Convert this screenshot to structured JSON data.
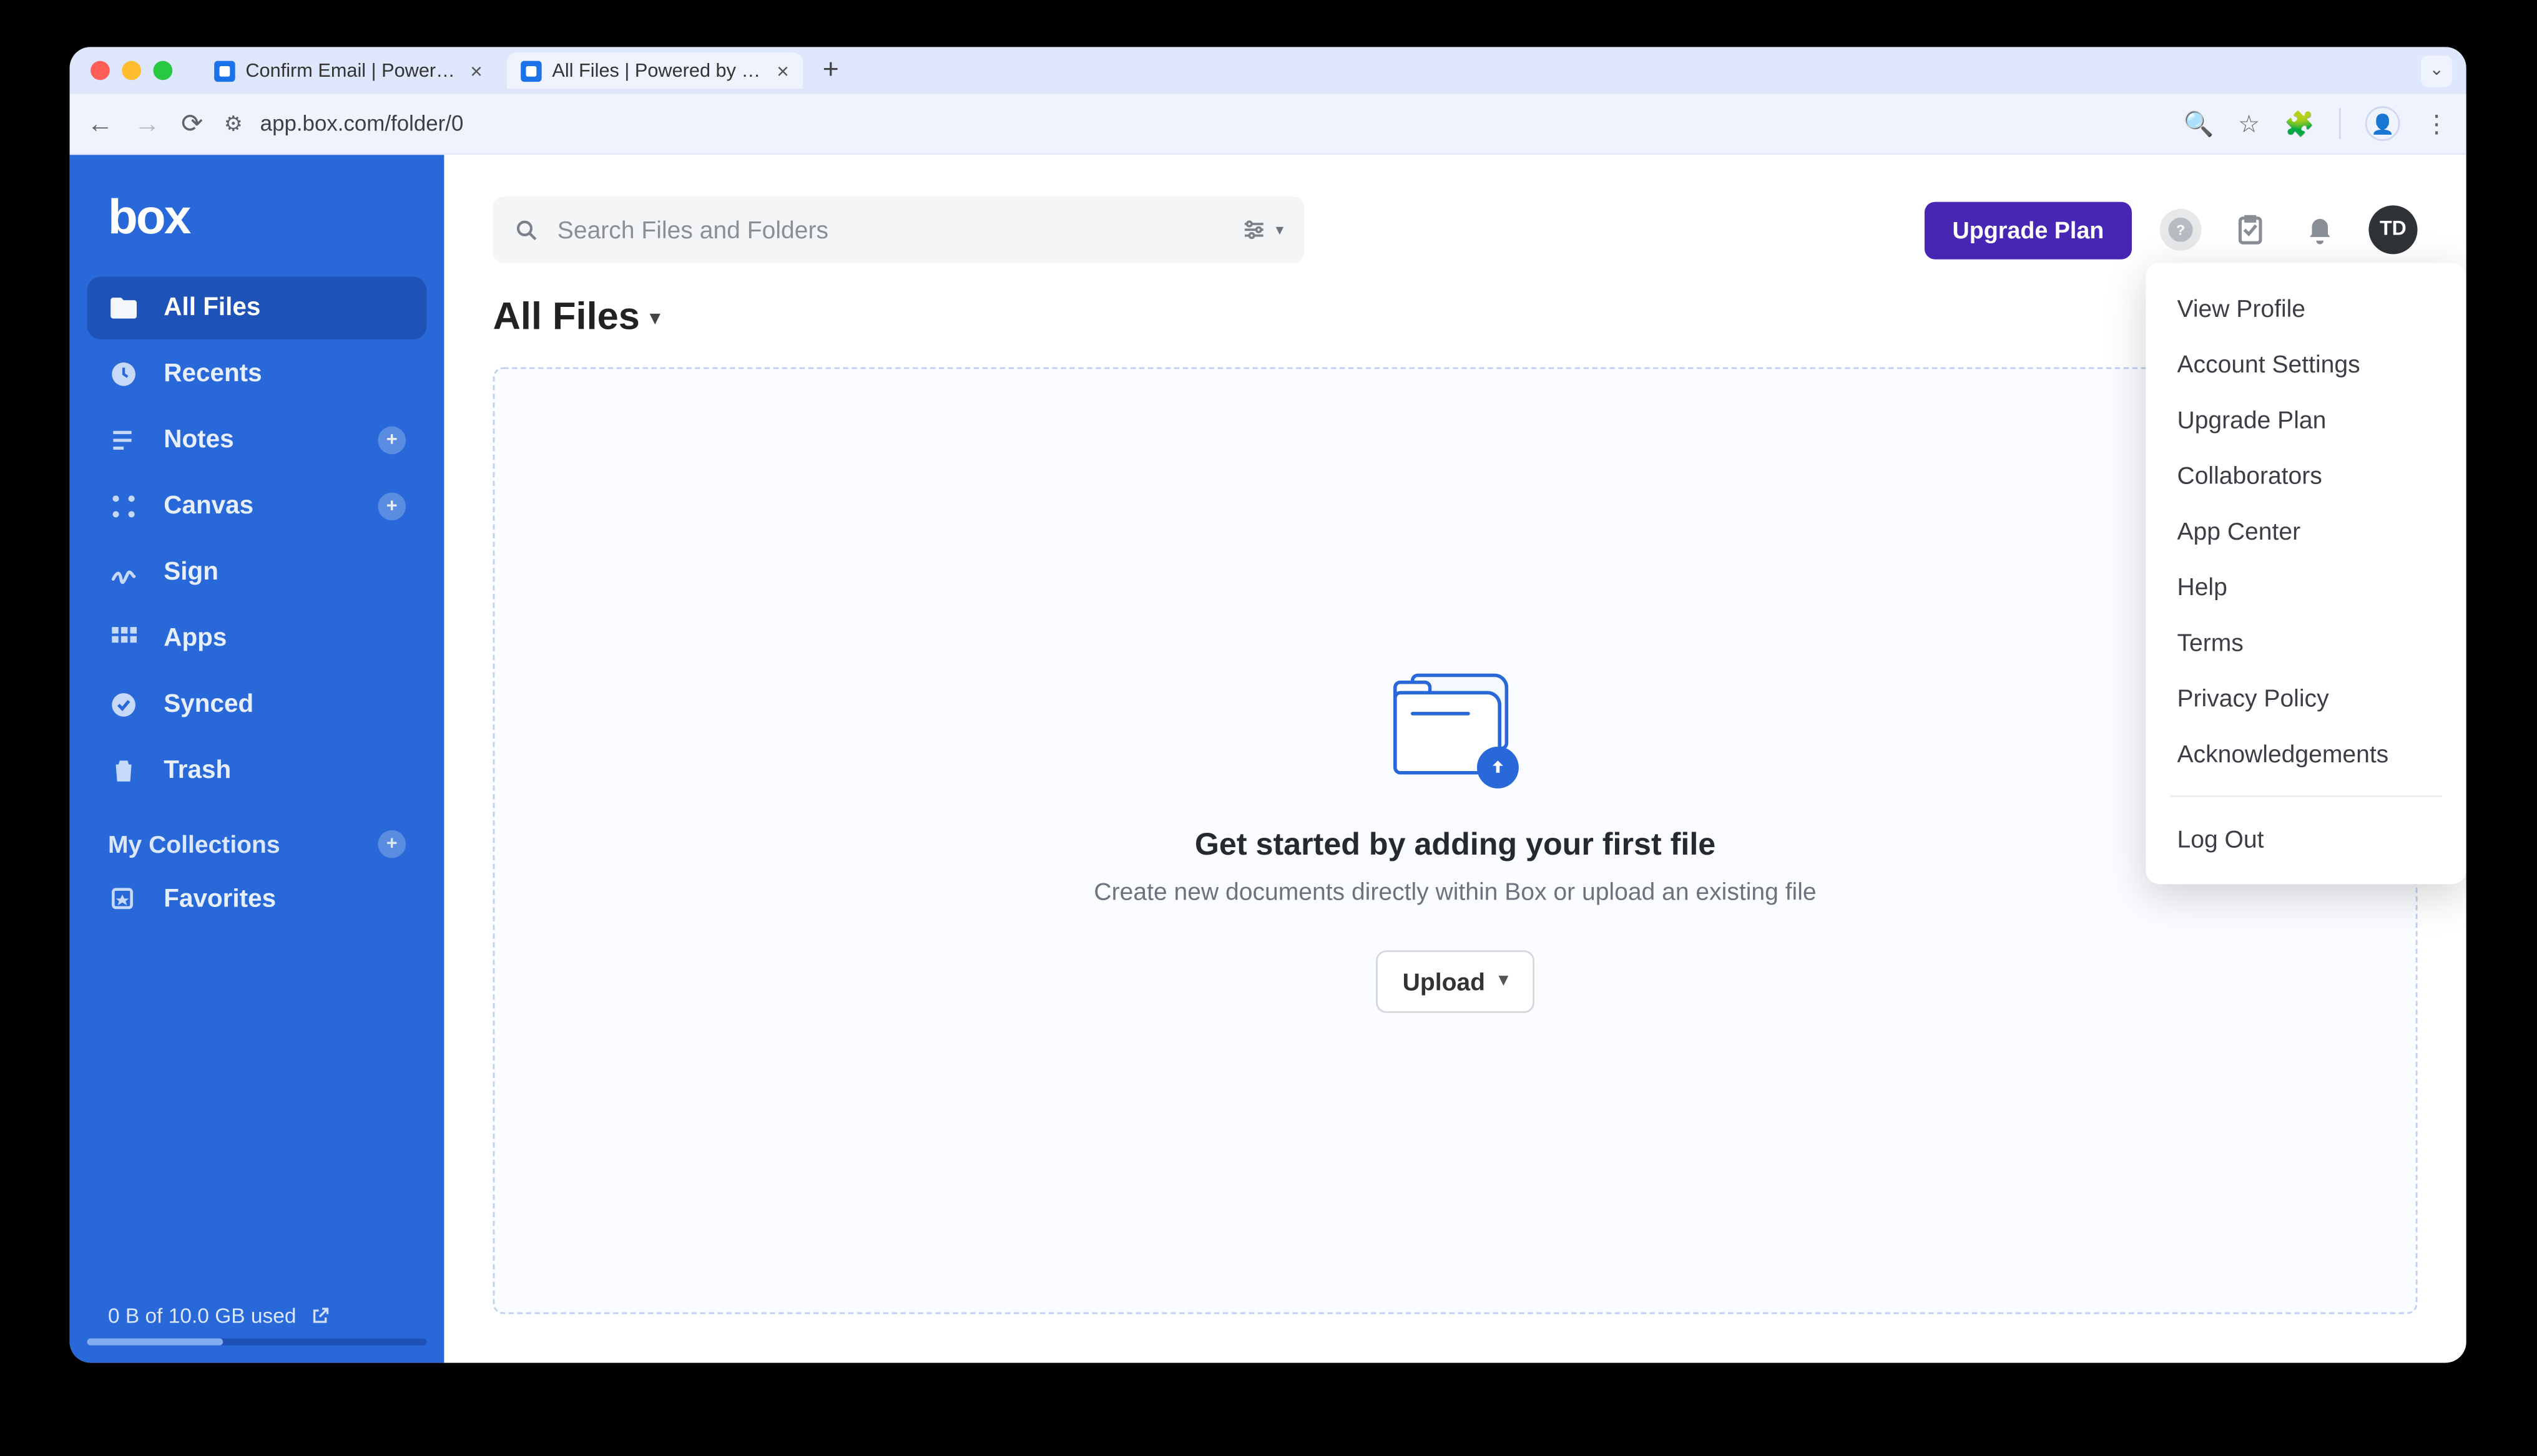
{
  "browser": {
    "tabs": [
      {
        "title": "Confirm Email | Powered by B"
      },
      {
        "title": "All Files | Powered by Box"
      }
    ],
    "url": "app.box.com/folder/0"
  },
  "sidebar": {
    "logo": "box",
    "items": [
      {
        "label": "All Files",
        "icon": "folder",
        "active": true
      },
      {
        "label": "Recents",
        "icon": "clock"
      },
      {
        "label": "Notes",
        "icon": "notes",
        "add": true
      },
      {
        "label": "Canvas",
        "icon": "canvas",
        "add": true
      },
      {
        "label": "Sign",
        "icon": "sign"
      },
      {
        "label": "Apps",
        "icon": "apps"
      },
      {
        "label": "Synced",
        "icon": "synced"
      },
      {
        "label": "Trash",
        "icon": "trash"
      }
    ],
    "collections_header": "My Collections",
    "collections": [
      {
        "label": "Favorites",
        "icon": "favorites"
      }
    ],
    "storage_text": "0 B of 10.0 GB used"
  },
  "header": {
    "search_placeholder": "Search Files and Folders",
    "upgrade_label": "Upgrade Plan",
    "avatar_initials": "TD"
  },
  "page": {
    "title": "All Files",
    "empty_title": "Get started by adding your first file",
    "empty_subtitle": "Create new documents directly within Box or upload an existing file",
    "upload_label": "Upload"
  },
  "profile_menu": {
    "items": [
      "View Profile",
      "Account Settings",
      "Upgrade Plan",
      "Collaborators",
      "App Center",
      "Help",
      "Terms",
      "Privacy Policy",
      "Acknowledgements"
    ],
    "logout": "Log Out"
  }
}
